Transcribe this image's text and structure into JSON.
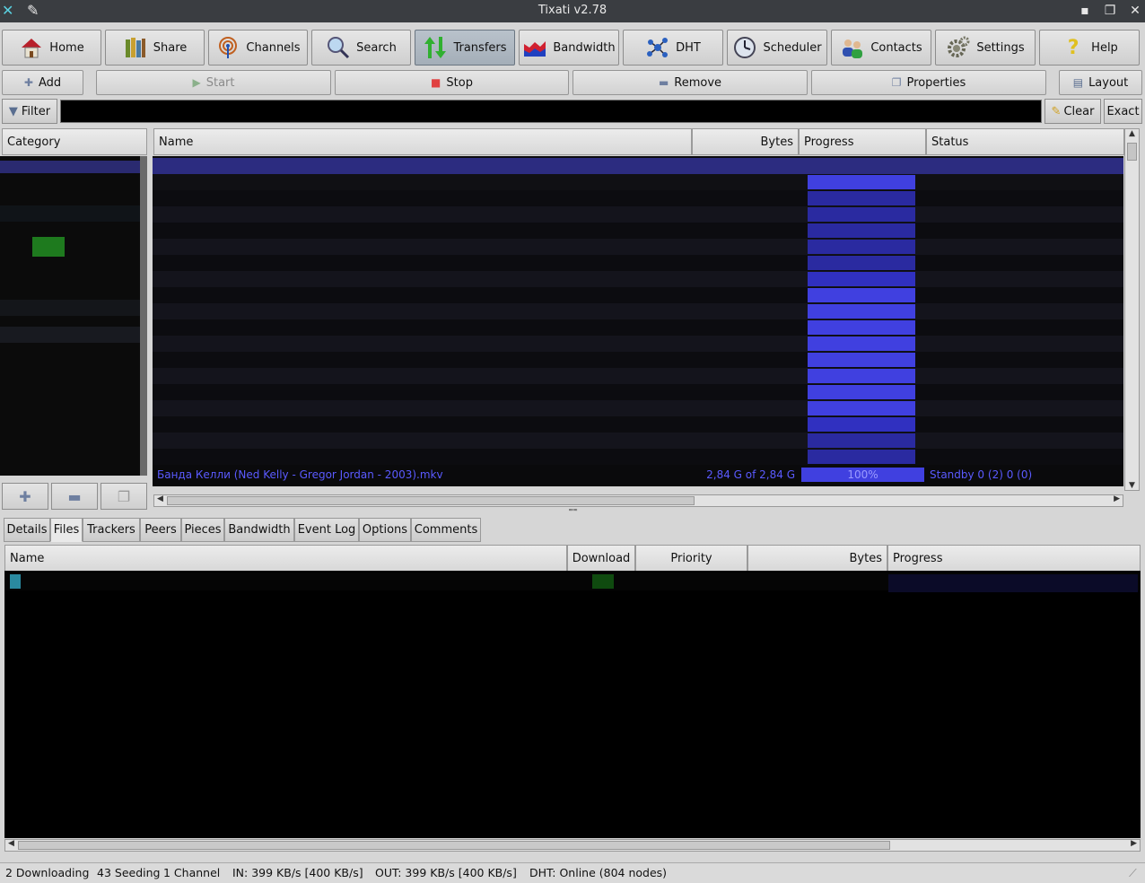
{
  "window": {
    "title": "Tixati v2.78"
  },
  "toolbar": {
    "home": "Home",
    "share": "Share",
    "channels": "Channels",
    "search": "Search",
    "transfers": "Transfers",
    "bandwidth": "Bandwidth",
    "dht": "DHT",
    "scheduler": "Scheduler",
    "contacts": "Contacts",
    "settings": "Settings",
    "help": "Help"
  },
  "actions": {
    "add": "Add",
    "start": "Start",
    "stop": "Stop",
    "remove": "Remove",
    "properties": "Properties",
    "layout": "Layout"
  },
  "filter": {
    "label": "Filter",
    "value": "",
    "clear": "Clear",
    "exact": "Exact"
  },
  "category_panel": {
    "header": "Category"
  },
  "transfers_table": {
    "columns": {
      "name": "Name",
      "bytes": "Bytes",
      "progress": "Progress",
      "status": "Status"
    },
    "visible_row": {
      "name": "Банда Келли (Ned Kelly - Gregor Jordan - 2003).mkv",
      "bytes": "2,84 G of 2,84 G",
      "progress": "100%",
      "status": "Standby 0 (2) 0 (0)"
    }
  },
  "detail_tabs": [
    "Details",
    "Files",
    "Trackers",
    "Peers",
    "Pieces",
    "Bandwidth",
    "Event Log",
    "Options",
    "Comments"
  ],
  "files_table": {
    "columns": {
      "name": "Name",
      "download": "Download",
      "priority": "Priority",
      "bytes": "Bytes",
      "progress": "Progress"
    }
  },
  "statusbar": {
    "downloading": "2 Downloading",
    "seeding": "43 Seeding",
    "channels": "1 Channel",
    "in": "IN: 399 KB/s [400 KB/s]",
    "out": "OUT: 399 KB/s [400 KB/s]",
    "dht": "DHT: Online (804 nodes)"
  },
  "colors": {
    "titlebar": "#3a3d41",
    "progress_fill": "#4040e0",
    "row_text": "#5a5aff",
    "table_bg": "#0a0a0c"
  }
}
